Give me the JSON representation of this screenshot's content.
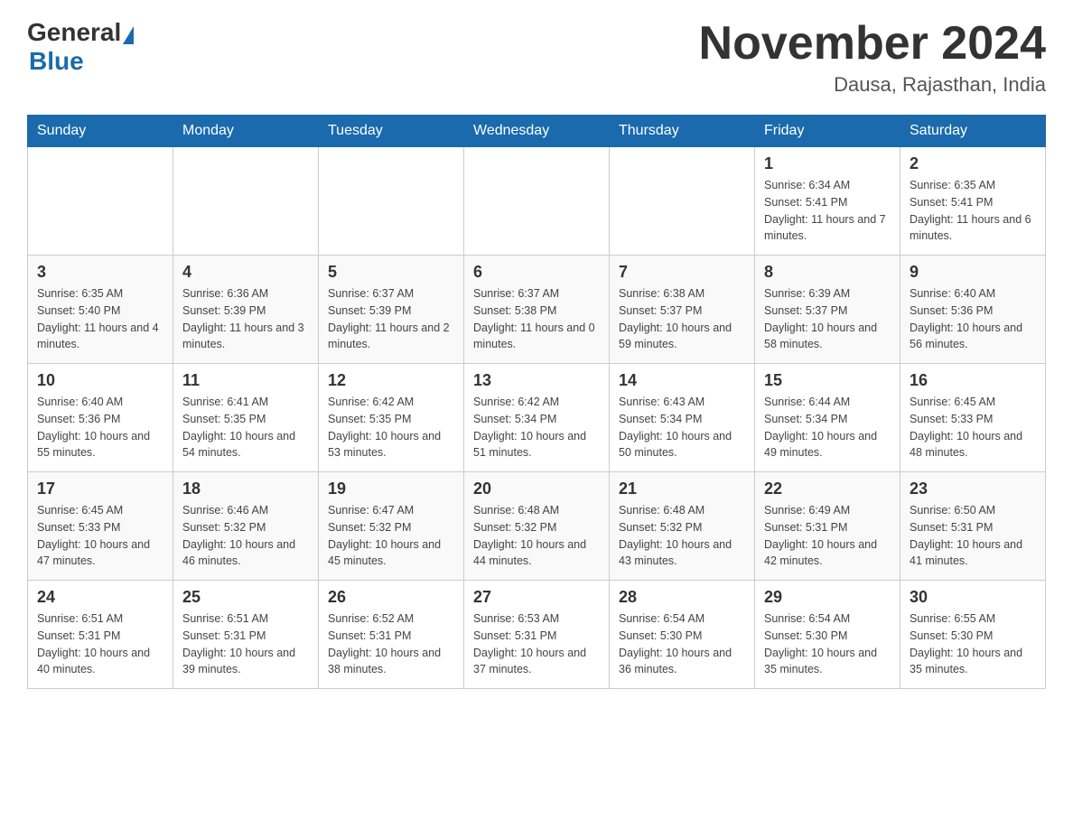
{
  "header": {
    "logo_general": "General",
    "logo_blue": "Blue",
    "title": "November 2024",
    "subtitle": "Dausa, Rajasthan, India"
  },
  "days_of_week": [
    "Sunday",
    "Monday",
    "Tuesday",
    "Wednesday",
    "Thursday",
    "Friday",
    "Saturday"
  ],
  "weeks": [
    [
      {
        "day": "",
        "info": ""
      },
      {
        "day": "",
        "info": ""
      },
      {
        "day": "",
        "info": ""
      },
      {
        "day": "",
        "info": ""
      },
      {
        "day": "",
        "info": ""
      },
      {
        "day": "1",
        "info": "Sunrise: 6:34 AM\nSunset: 5:41 PM\nDaylight: 11 hours and 7 minutes."
      },
      {
        "day": "2",
        "info": "Sunrise: 6:35 AM\nSunset: 5:41 PM\nDaylight: 11 hours and 6 minutes."
      }
    ],
    [
      {
        "day": "3",
        "info": "Sunrise: 6:35 AM\nSunset: 5:40 PM\nDaylight: 11 hours and 4 minutes."
      },
      {
        "day": "4",
        "info": "Sunrise: 6:36 AM\nSunset: 5:39 PM\nDaylight: 11 hours and 3 minutes."
      },
      {
        "day": "5",
        "info": "Sunrise: 6:37 AM\nSunset: 5:39 PM\nDaylight: 11 hours and 2 minutes."
      },
      {
        "day": "6",
        "info": "Sunrise: 6:37 AM\nSunset: 5:38 PM\nDaylight: 11 hours and 0 minutes."
      },
      {
        "day": "7",
        "info": "Sunrise: 6:38 AM\nSunset: 5:37 PM\nDaylight: 10 hours and 59 minutes."
      },
      {
        "day": "8",
        "info": "Sunrise: 6:39 AM\nSunset: 5:37 PM\nDaylight: 10 hours and 58 minutes."
      },
      {
        "day": "9",
        "info": "Sunrise: 6:40 AM\nSunset: 5:36 PM\nDaylight: 10 hours and 56 minutes."
      }
    ],
    [
      {
        "day": "10",
        "info": "Sunrise: 6:40 AM\nSunset: 5:36 PM\nDaylight: 10 hours and 55 minutes."
      },
      {
        "day": "11",
        "info": "Sunrise: 6:41 AM\nSunset: 5:35 PM\nDaylight: 10 hours and 54 minutes."
      },
      {
        "day": "12",
        "info": "Sunrise: 6:42 AM\nSunset: 5:35 PM\nDaylight: 10 hours and 53 minutes."
      },
      {
        "day": "13",
        "info": "Sunrise: 6:42 AM\nSunset: 5:34 PM\nDaylight: 10 hours and 51 minutes."
      },
      {
        "day": "14",
        "info": "Sunrise: 6:43 AM\nSunset: 5:34 PM\nDaylight: 10 hours and 50 minutes."
      },
      {
        "day": "15",
        "info": "Sunrise: 6:44 AM\nSunset: 5:34 PM\nDaylight: 10 hours and 49 minutes."
      },
      {
        "day": "16",
        "info": "Sunrise: 6:45 AM\nSunset: 5:33 PM\nDaylight: 10 hours and 48 minutes."
      }
    ],
    [
      {
        "day": "17",
        "info": "Sunrise: 6:45 AM\nSunset: 5:33 PM\nDaylight: 10 hours and 47 minutes."
      },
      {
        "day": "18",
        "info": "Sunrise: 6:46 AM\nSunset: 5:32 PM\nDaylight: 10 hours and 46 minutes."
      },
      {
        "day": "19",
        "info": "Sunrise: 6:47 AM\nSunset: 5:32 PM\nDaylight: 10 hours and 45 minutes."
      },
      {
        "day": "20",
        "info": "Sunrise: 6:48 AM\nSunset: 5:32 PM\nDaylight: 10 hours and 44 minutes."
      },
      {
        "day": "21",
        "info": "Sunrise: 6:48 AM\nSunset: 5:32 PM\nDaylight: 10 hours and 43 minutes."
      },
      {
        "day": "22",
        "info": "Sunrise: 6:49 AM\nSunset: 5:31 PM\nDaylight: 10 hours and 42 minutes."
      },
      {
        "day": "23",
        "info": "Sunrise: 6:50 AM\nSunset: 5:31 PM\nDaylight: 10 hours and 41 minutes."
      }
    ],
    [
      {
        "day": "24",
        "info": "Sunrise: 6:51 AM\nSunset: 5:31 PM\nDaylight: 10 hours and 40 minutes."
      },
      {
        "day": "25",
        "info": "Sunrise: 6:51 AM\nSunset: 5:31 PM\nDaylight: 10 hours and 39 minutes."
      },
      {
        "day": "26",
        "info": "Sunrise: 6:52 AM\nSunset: 5:31 PM\nDaylight: 10 hours and 38 minutes."
      },
      {
        "day": "27",
        "info": "Sunrise: 6:53 AM\nSunset: 5:31 PM\nDaylight: 10 hours and 37 minutes."
      },
      {
        "day": "28",
        "info": "Sunrise: 6:54 AM\nSunset: 5:30 PM\nDaylight: 10 hours and 36 minutes."
      },
      {
        "day": "29",
        "info": "Sunrise: 6:54 AM\nSunset: 5:30 PM\nDaylight: 10 hours and 35 minutes."
      },
      {
        "day": "30",
        "info": "Sunrise: 6:55 AM\nSunset: 5:30 PM\nDaylight: 10 hours and 35 minutes."
      }
    ]
  ]
}
